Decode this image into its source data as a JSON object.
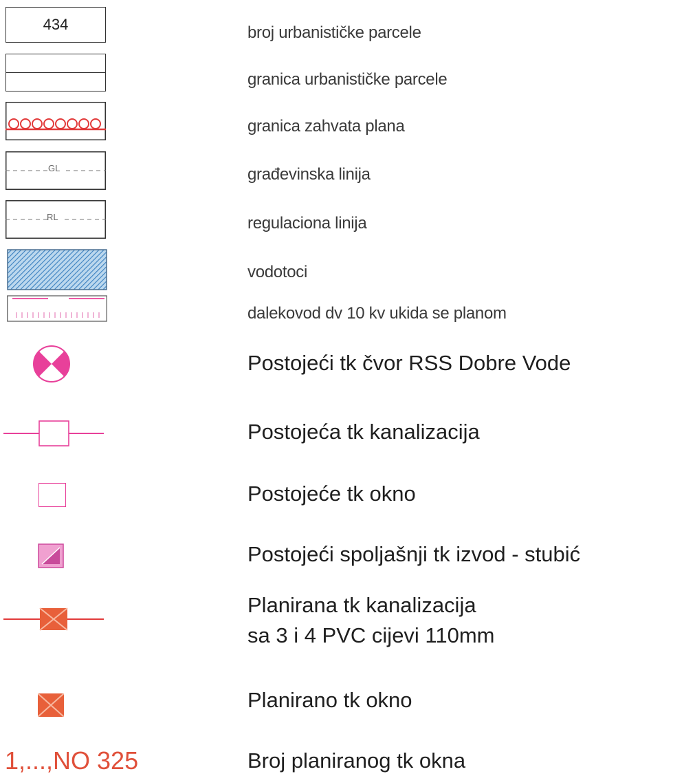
{
  "legend": [
    {
      "symbol": "parcel-number-box",
      "number": "434",
      "label": "broj urbanističke parcele"
    },
    {
      "symbol": "parcel-boundary",
      "label": "granica urbanističke parcele"
    },
    {
      "symbol": "plan-boundary",
      "label": "granica zahvata plana"
    },
    {
      "symbol": "building-line",
      "code": "GL",
      "label": "građevinska linija"
    },
    {
      "symbol": "regulation-line",
      "code": "RL",
      "label": "regulaciona linija"
    },
    {
      "symbol": "watercourse-hatch",
      "label": "vodotoci"
    },
    {
      "symbol": "power-line",
      "label": "dalekovod dv 10 kv ukida se planom"
    },
    {
      "symbol": "tk-node-circle",
      "label": "Postojeći tk čvor RSS Dobre Vode"
    },
    {
      "symbol": "existing-sewer",
      "label": "Postojeća tk kanalizacija"
    },
    {
      "symbol": "existing-manhole",
      "label": "Postojeće tk okno"
    },
    {
      "symbol": "outlet-post",
      "label": "Postojeći spoljašnji tk izvod - stubić"
    },
    {
      "symbol": "planned-sewer",
      "label": "Planirana tk kanalizacija",
      "label_line2": "sa 3 i 4 PVC cijevi 110mm"
    },
    {
      "symbol": "planned-manhole",
      "label": "Planirano tk okno"
    },
    {
      "symbol": "manhole-number",
      "tag": "1,...,NO 325",
      "label": "Broj planiranog tk okna"
    }
  ],
  "colors": {
    "outline": "#333333",
    "magenta": "#e8409a",
    "pink_fill": "#f0a0d0",
    "red": "#e23a3a",
    "orange": "#e8603a",
    "hatch_blue": "#3a80c0",
    "hatch_bg": "#bcd8ee"
  }
}
